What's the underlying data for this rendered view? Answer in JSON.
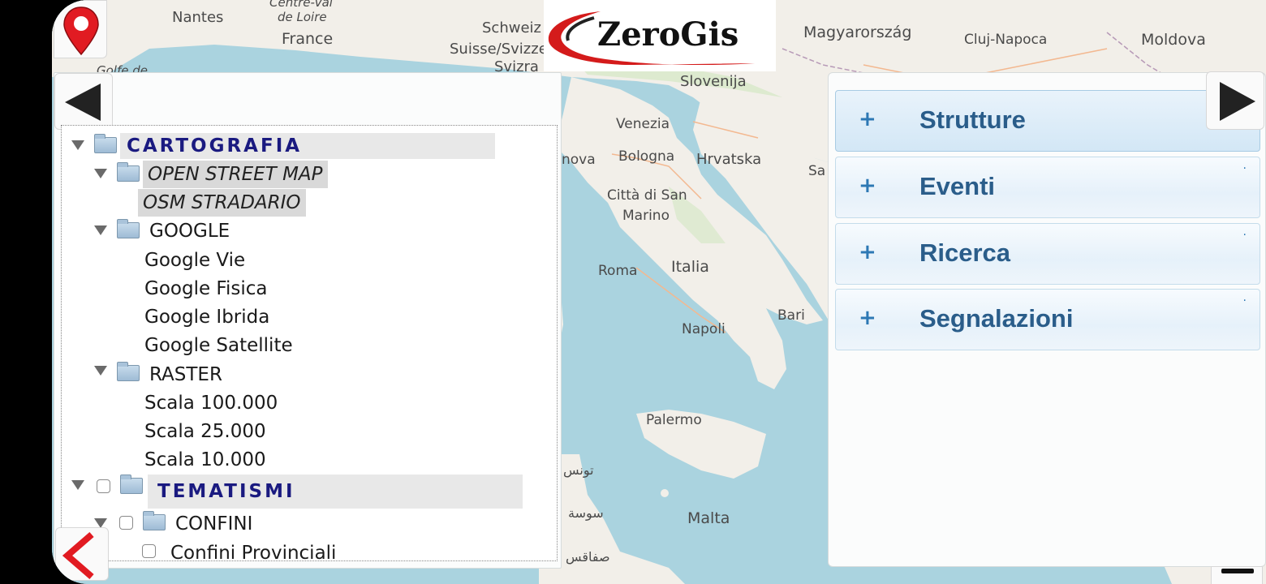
{
  "map": {
    "labels": [
      {
        "text": "Nantes"
      },
      {
        "text": "Centre-Val"
      },
      {
        "text": "de Loire"
      },
      {
        "text": "France"
      },
      {
        "text": "Schweiz"
      },
      {
        "text": "Suisse/Svizzera"
      },
      {
        "text": "Svizra"
      },
      {
        "text": "Magyarország"
      },
      {
        "text": "Cluj-Napoca"
      },
      {
        "text": "Moldova"
      },
      {
        "text": "Slovenija"
      },
      {
        "text": "Venezia"
      },
      {
        "text": "Bologna"
      },
      {
        "text": "Hrvatska"
      },
      {
        "text": "Città di San"
      },
      {
        "text": "Marino"
      },
      {
        "text": "Roma"
      },
      {
        "text": "Italia"
      },
      {
        "text": "Bari"
      },
      {
        "text": "Napoli"
      },
      {
        "text": "Palermo"
      },
      {
        "text": "Malta"
      },
      {
        "text": "تونس"
      },
      {
        "text": "سوسة"
      },
      {
        "text": "صفاقس"
      },
      {
        "text": "nova"
      },
      {
        "text": "Sa"
      },
      {
        "text": "Golfe de"
      }
    ]
  },
  "logo": {
    "text": "ZeroGis"
  },
  "tree": {
    "cartografia": "CARTOGRAFIA",
    "osm": "OPEN STREET MAP",
    "osm_stradario": "OSM STRADARIO",
    "google": "GOOGLE",
    "google_items": [
      "Google Vie",
      "Google Fisica",
      "Google Ibrida",
      "Google Satellite"
    ],
    "raster": "RASTER",
    "raster_items": [
      "Scala 100.000",
      "Scala 25.000",
      "Scala 10.000"
    ],
    "tematismi": "TEMATISMI",
    "confini": "CONFINI",
    "confini_provinciali": "Confini Provinciali"
  },
  "accordion": {
    "plus": "+",
    "items": [
      {
        "label": "Strutture"
      },
      {
        "label": "Eventi"
      },
      {
        "label": "Ricerca"
      },
      {
        "label": "Segnalazioni"
      }
    ]
  },
  "colors": {
    "accent": "#2a5d8a",
    "header_text": "#1a1a80",
    "marker": "#e11b22"
  }
}
